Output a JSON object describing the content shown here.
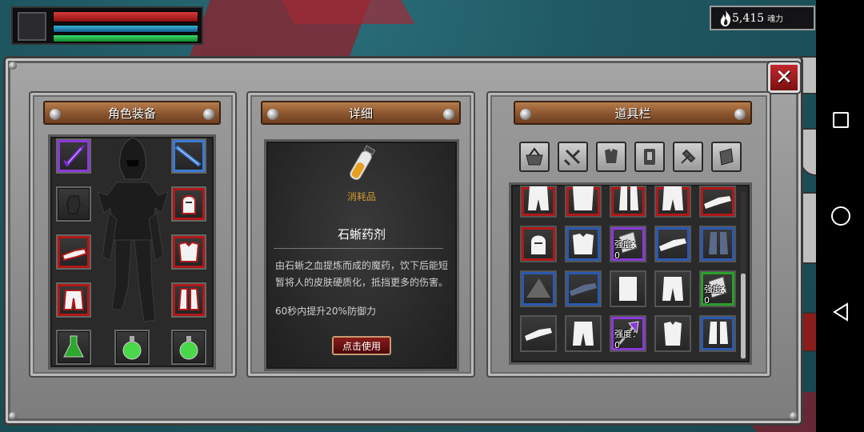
{
  "status": {
    "hp": 1.0,
    "mp": 1.0,
    "stamina": 1.0
  },
  "currency": {
    "amount": "5,415",
    "unit": "魂力",
    "icon": "flame-icon"
  },
  "equipment": {
    "title": "角色装备",
    "slots": [
      {
        "name": "weapon-slot",
        "icon": "sword-icon",
        "rarity": "purple"
      },
      {
        "name": "glove-slot",
        "icon": "glove-icon",
        "rarity": "none"
      },
      {
        "name": "arm-slot",
        "icon": "bracer-icon",
        "rarity": "red"
      },
      {
        "name": "legs-slot",
        "icon": "pants-icon",
        "rarity": "red"
      },
      {
        "name": "potion-slot-1",
        "icon": "flask-icon",
        "rarity": "none"
      },
      {
        "name": "potion-slot-2",
        "icon": "round-flask-icon",
        "rarity": "none"
      },
      {
        "name": "offhand-slot",
        "icon": "blade-icon",
        "rarity": "blue"
      },
      {
        "name": "helmet-slot",
        "icon": "helmet-icon",
        "rarity": "red"
      },
      {
        "name": "chest-slot",
        "icon": "chest-armor-icon",
        "rarity": "red"
      },
      {
        "name": "boots-slot",
        "icon": "boots-icon",
        "rarity": "red"
      },
      {
        "name": "potion-slot-3",
        "icon": "round-flask-icon",
        "rarity": "none"
      }
    ]
  },
  "details": {
    "title": "详细",
    "category": "消耗品",
    "item_name": "石蜥药剂",
    "description": "由石蜥之血提炼而成的魔药，饮下后能短暂将人的皮肤硬质化，抵挡更多的伤害。",
    "effect": "60秒内提升20%防御力",
    "use_button": "点击使用",
    "icon": "potion-vial-icon"
  },
  "inventory": {
    "title": "道具栏",
    "tabs": [
      "basket-icon",
      "weapon-icon",
      "armor-icon",
      "accessory-icon",
      "craft-icon",
      "scroll-icon"
    ],
    "strength_label": "强度：0"
  }
}
